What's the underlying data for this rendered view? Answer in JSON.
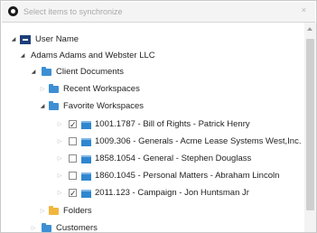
{
  "search": {
    "placeholder": "Select items to synchronize",
    "clear": "×"
  },
  "tree": {
    "root": "User Name",
    "avatar_glyph": "▬",
    "company": "Adams Adams and Webster LLC",
    "client_documents": "Client Documents",
    "recent_workspaces": "Recent Workspaces",
    "favorite_workspaces": "Favorite Workspaces",
    "workspaces": [
      {
        "label": "1001.1787 - Bill of Rights - Patrick Henry",
        "checked": true
      },
      {
        "label": "1009.306 - Generals - Acme Lease Systems West,Inc.",
        "checked": false
      },
      {
        "label": "1858.1054 - General - Stephen Douglass",
        "checked": false
      },
      {
        "label": "1860.1045 - Personal Matters - Abraham Lincoln",
        "checked": false
      },
      {
        "label": "2011.123 - Campaign - Jon Huntsman Jr",
        "checked": true
      }
    ],
    "folders": "Folders",
    "customers": "Customers"
  },
  "glyphs": {
    "expanded": "◢",
    "collapsed": "▷",
    "check": "✓"
  },
  "colors": {
    "folder_blue": "#3d8fd4",
    "folder_yellow": "#f0b63f",
    "workspace_blue": "#2f86d0",
    "avatar_navy": "#1e3f78"
  }
}
